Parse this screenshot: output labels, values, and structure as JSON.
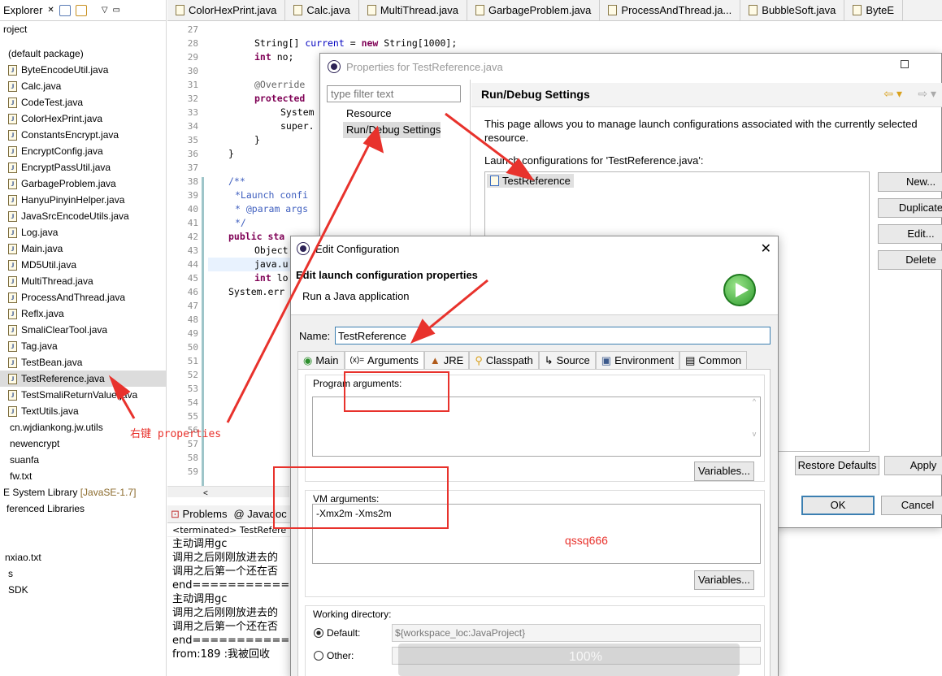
{
  "explorer": {
    "tab_label": "Explorer",
    "close_glyph": "✕",
    "project": "roject",
    "package": "(default package)",
    "files": [
      "ByteEncodeUtil.java",
      "Calc.java",
      "CodeTest.java",
      "ColorHexPrint.java",
      "ConstantsEncrypt.java",
      "EncryptConfig.java",
      "EncryptPassUtil.java",
      "GarbageProblem.java",
      "HanyuPinyinHelper.java",
      "JavaSrcEncodeUtils.java",
      "Log.java",
      "Main.java",
      "MD5Util.java",
      "MultiThread.java",
      "ProcessAndThread.java",
      "Reflx.java",
      "SmaliClearTool.java",
      "Tag.java",
      "TestBean.java",
      "TestReference.java",
      "TestSmaliReturnValue.java",
      "TextUtils.java"
    ],
    "other_items": [
      "cn.wjdiankong.jw.utils",
      "newencrypt",
      "suanfa",
      "fw.txt"
    ],
    "library": "E System Library",
    "library_version": "[JavaSE-1.7]",
    "referenced": "ferenced Libraries",
    "bottom_items": [
      "nxiao.txt",
      "s",
      "SDK"
    ]
  },
  "editor": {
    "tabs": [
      "ColorHexPrint.java",
      "Calc.java",
      "MultiThread.java",
      "GarbageProblem.java",
      "ProcessAndThread.ja...",
      "BubbleSoft.java",
      "ByteE"
    ],
    "line_numbers": [
      "27",
      "28",
      "29",
      "30",
      "31",
      "32",
      "33",
      "34",
      "35",
      "36",
      "37",
      "38",
      "39",
      "40",
      "41",
      "42",
      "43",
      "44",
      "45",
      "46",
      "47",
      "48",
      "49",
      "50",
      "51",
      "52",
      "53",
      "54",
      "55",
      "56",
      "57",
      "58",
      "59"
    ],
    "code": {
      "l28_type": "String[] ",
      "l28_field": "current",
      "l28_eq": " = ",
      "l28_new": "new",
      "l28_rest": " String[1000];",
      "l29_kw": "int",
      "l29_field": " no;",
      "l31": "@Override",
      "l32": "protected",
      "l33": "System",
      "l34": "super.",
      "l35": "}",
      "l36": "}",
      "l38": "/**",
      "l39": "*Launch confi",
      "l40": "* @param args",
      "l41": "*/",
      "l42_kw": "public sta",
      "l43": "Object",
      "l44": "java.u",
      "l45": "int lo",
      "l46": "System.err"
    }
  },
  "console": {
    "tabs": [
      "Problems",
      "Javadoc"
    ],
    "terminated": "<terminated> TestRefere",
    "lines": [
      "主动调用gc",
      "调用之后刚刚放进去的",
      "调用之后第一个还在否",
      "end==============",
      "主动调用gc",
      "调用之后刚刚放进去的",
      "调用之后第一个还在否",
      "end==============",
      "from:189 :我被回收"
    ]
  },
  "properties_dialog": {
    "title": "Properties for TestReference.java",
    "filter_placeholder": "type filter text",
    "nav": [
      "Resource",
      "Run/Debug Settings"
    ],
    "heading": "Run/Debug Settings",
    "description": "This page allows you to manage launch configurations associated with the currently selected resource.",
    "configs_label": "Launch configurations for 'TestReference.java':",
    "configs": [
      "TestReference"
    ],
    "side_buttons": [
      "New...",
      "Duplicate",
      "Edit...",
      "Delete"
    ],
    "restore": "Restore Defaults",
    "apply": "Apply",
    "ok": "OK",
    "cancel": "Cancel"
  },
  "edit_dialog": {
    "title": "Edit Configuration",
    "heading": "Edit launch configuration properties",
    "subheading": "Run a Java application",
    "name_label": "Name:",
    "name_value": "TestReference",
    "tabs": [
      "Main",
      "Arguments",
      "JRE",
      "Classpath",
      "Source",
      "Environment",
      "Common"
    ],
    "program_args_label": "Program arguments:",
    "variables_btn": "Variables...",
    "vm_args_label": "VM arguments:",
    "vm_args_value": "-Xmx2m -Xms2m",
    "working_dir_label": "Working directory:",
    "default_label": "Default:",
    "default_value": "${workspace_loc:JavaProject}",
    "other_label": "Other:"
  },
  "annotations": {
    "right_click": "右键 properties",
    "watermark": "qssq666",
    "zoom": "100%"
  },
  "colors": {
    "annotation_red": "#e8322c",
    "selection": "#dcdcdc",
    "keyword": "#7f0055",
    "field": "#0000c0"
  }
}
